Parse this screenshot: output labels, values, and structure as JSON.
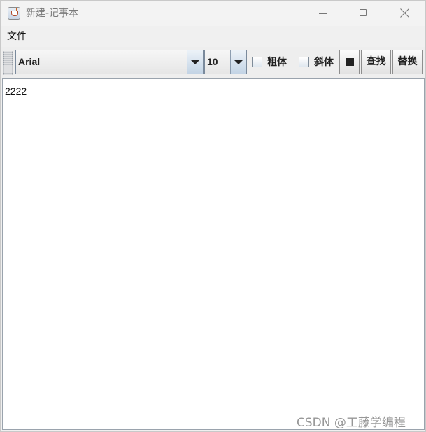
{
  "window": {
    "title": "新建-记事本"
  },
  "menu": {
    "items": [
      {
        "label": "文件"
      }
    ]
  },
  "toolbar": {
    "font_name": "Arial",
    "font_size": "10",
    "bold_label": "粗体",
    "bold_checked": false,
    "italic_label": "斜体",
    "italic_checked": false,
    "color_icon": "color-square-icon",
    "color_value": "#222222",
    "find_label": "查找",
    "replace_label": "替换"
  },
  "editor": {
    "content": "2222"
  },
  "watermark": {
    "text": "CSDN @工藤学编程"
  }
}
